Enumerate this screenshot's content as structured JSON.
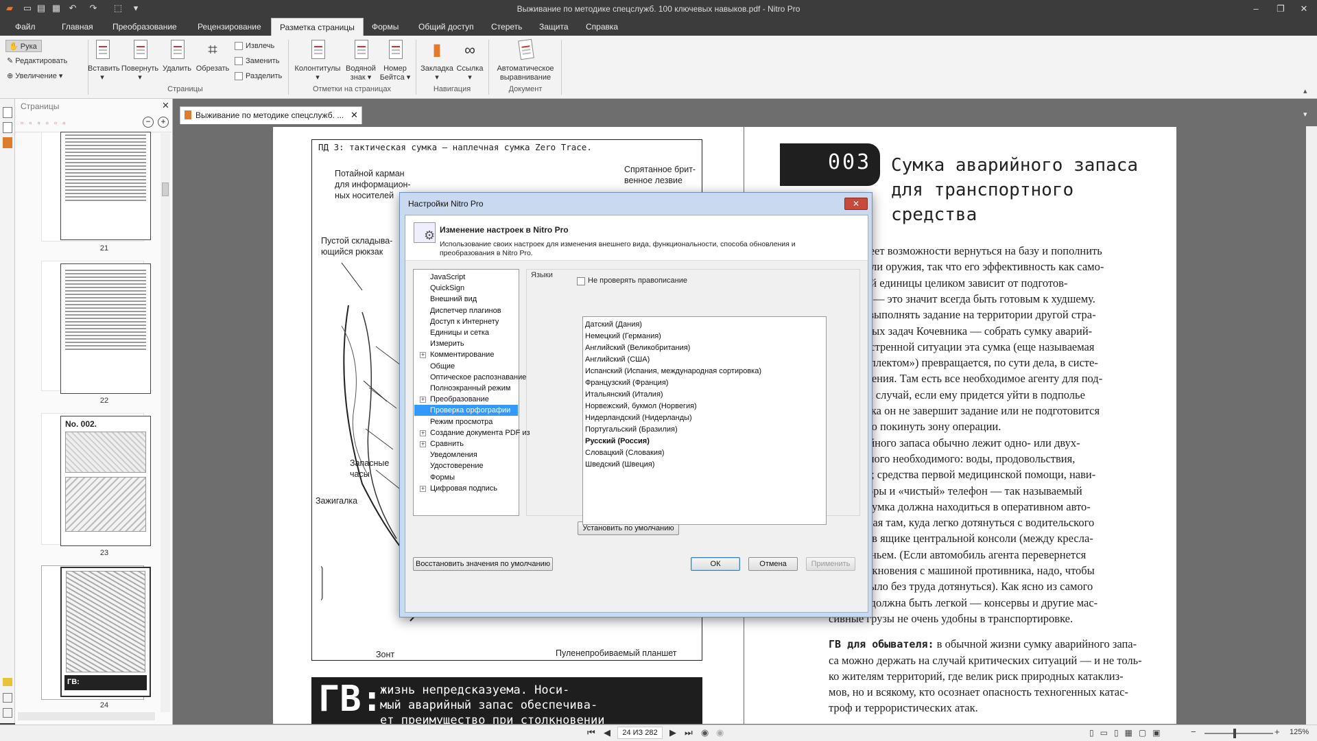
{
  "window": {
    "title": "Выживание по методике спецслужб. 100 ключевых навыков.pdf - Nitro Pro",
    "controls": {
      "minimize": "–",
      "restore": "❐",
      "close": "✕"
    }
  },
  "menu_tabs": [
    "Файл",
    "Главная",
    "Преобразование",
    "Рецензирование",
    "Разметка страницы",
    "Формы",
    "Общий доступ",
    "Стереть",
    "Защита",
    "Справка"
  ],
  "active_tab": "Разметка страницы",
  "ribbon": {
    "tools": {
      "hand": "Рука",
      "edit": "Редактировать",
      "zoom": "Увеличение"
    },
    "pages_group": {
      "insert": "Вставить",
      "rotate": "Повернуть",
      "delete": "Удалить",
      "crop": "Обрезать",
      "extract": "Извлечь",
      "replace": "Заменить",
      "split": "Разделить",
      "label": "Страницы"
    },
    "marks_group": {
      "headers": "Колонтитулы",
      "watermark_1": "Водяной",
      "watermark_2": "знак",
      "bates_1": "Номер",
      "bates_2": "Бейтса",
      "label": "Отметки на страницах"
    },
    "nav_group": {
      "bookmark": "Закладка",
      "link": "Ссылка",
      "label": "Навигация"
    },
    "doc_group": {
      "auto_1": "Автоматическое",
      "auto_2": "выравнивание",
      "label": "Документ"
    }
  },
  "pages_panel": {
    "title": "Страницы",
    "page_numbers": [
      "21",
      "22",
      "23",
      "24"
    ],
    "thumb_label_23": "No. 002.",
    "thumb_label_24": "ГВ:"
  },
  "document_tab": "Выживание по методике спецслужб. ...",
  "left_page": {
    "header": "ПД 3: тактическая сумка — наплечная сумка Zero Trace.",
    "labels": {
      "hidden_pocket": [
        "Потайной карман",
        "для информацион-",
        "ных носителей"
      ],
      "blade": [
        "Спрятанное брит-",
        "венное лезвие"
      ],
      "backpack": [
        "Пустой складыва-",
        "ющийся рюкзак"
      ],
      "watch": [
        "Запасные",
        "часы"
      ],
      "lighter": "Зажигалка",
      "umbrella": "Зонт",
      "tablet": "Пуленепробиваемый планшет"
    },
    "footer_big": "ГВ:",
    "footer_text": [
      "жизнь непредсказуема. Носи-",
      "мый аварийный запас обеспечива-",
      "ет преимущество при столкновении"
    ]
  },
  "right_page": {
    "badge": "003",
    "title": [
      "Сумка аварийного запаса",
      "для транспортного",
      "средства"
    ],
    "lines": [
      "нт не имеет возможности вернуться на базу и пополнить",
      "овизии или оружия, так что его эффективность как само-",
      "ой боевой единицы целиком зависит от подготов-",
      "дготовка — это значит всегда быть готовым к худшему.",
      "едстоит выполнять задание на территории другой стра-",
      "а из первых задач Кочевника — собрать сумку аварий-",
      "аса. В экстренной ситуации эта сумка (еще называемая",
      "ным комплектом») превращается, по сути дела, в систе-",
      "еобеспечения. Там есть все необходимое агенту для под-",
      "жизни на случай, если ему придется уйти в подполье",
      "аться, пока он не завершит задание или не подготовится",
      "безопасно покинуть зону операции.",
      "ке аварийного запаса обычно лежит одно- или двух-",
      "запас самого необходимого: воды, продовольствия,",
      "ых денег; средства первой медицинской помощи, нави-",
      "ые приборы и «чистый» телефон — так называемый",
      "овый». Сумка должна находиться в оперативном авто-",
      "спрятанная там, куда легко дотянуться с водительского",
      "апример в ящике центральной консоли (между кресла-",
      "под сиденьем. (Если автомобиль агента перевернется",
      "тате столкновения с машиной противника, надо, чтобы",
      "можно было без труда дотянуться). Как ясно из самого",
      "я, сумка должна быть легкой — консервы и другие мас-",
      "сивные грузы не очень удобны в транспортировке."
    ],
    "gv_label": "ГВ для обывателя:",
    "gv_lines": [
      " в обычной жизни сумку аварийного запа-",
      "са можно держать на случай критических ситуаций — и не толь-",
      "ко жителям территорий, где велик риск природных катаклиз-",
      "мов, но и всякому, кто осознает опасность техногенных катас-",
      "троф и террористических атак."
    ]
  },
  "dialog": {
    "title": "Настройки Nitro Pro",
    "heading": "Изменение настроек в Nitro Pro",
    "description": "Использование своих настроек для изменения внешнего вида, функциональности, способа обновления и преобразования в Nitro Pro.",
    "tree": [
      {
        "label": "JavaScript",
        "expand": false
      },
      {
        "label": "QuickSign",
        "expand": false
      },
      {
        "label": "Внешний вид",
        "expand": false
      },
      {
        "label": "Диспетчер плагинов",
        "expand": false
      },
      {
        "label": "Доступ к Интернету",
        "expand": false
      },
      {
        "label": "Единицы и сетка",
        "expand": false
      },
      {
        "label": "Измерить",
        "expand": false
      },
      {
        "label": "Комментирование",
        "expand": true
      },
      {
        "label": "Общие",
        "expand": false
      },
      {
        "label": "Оптическое распознавание",
        "expand": false
      },
      {
        "label": "Полноэкранный режим",
        "expand": false
      },
      {
        "label": "Преобразование",
        "expand": true
      },
      {
        "label": "Проверка орфографии",
        "expand": false,
        "selected": true
      },
      {
        "label": "Режим просмотра",
        "expand": false
      },
      {
        "label": "Создание документа PDF из",
        "expand": true
      },
      {
        "label": "Сравнить",
        "expand": true
      },
      {
        "label": "Уведомления",
        "expand": false
      },
      {
        "label": "Удостоверение",
        "expand": false
      },
      {
        "label": "Формы",
        "expand": false
      },
      {
        "label": "Цифровая подпись",
        "expand": true
      }
    ],
    "section_title": "Языки",
    "checkbox_label": "Не проверять правописание",
    "languages": [
      "Датский (Дания)",
      "Немецкий (Германия)",
      "Английский (Великобритания)",
      "Английский (США)",
      "Испанский (Испания, международная сортировка)",
      "Французский (Франция)",
      "Итальянский (Италия)",
      "Норвежский, букмол (Норвегия)",
      "Нидерландский (Нидерланды)",
      "Португальский (Бразилия)",
      "Русский (Россия)",
      "Словацкий (Словакия)",
      "Шведский (Швеция)"
    ],
    "selected_language": "Русский (Россия)",
    "set_default": "Установить по умолчанию",
    "restore_defaults": "Восстановить значения по умолчанию",
    "ok": "ОК",
    "cancel": "Отмена",
    "apply": "Применить"
  },
  "status": {
    "page": "24 ИЗ 282",
    "zoom": "125%"
  }
}
